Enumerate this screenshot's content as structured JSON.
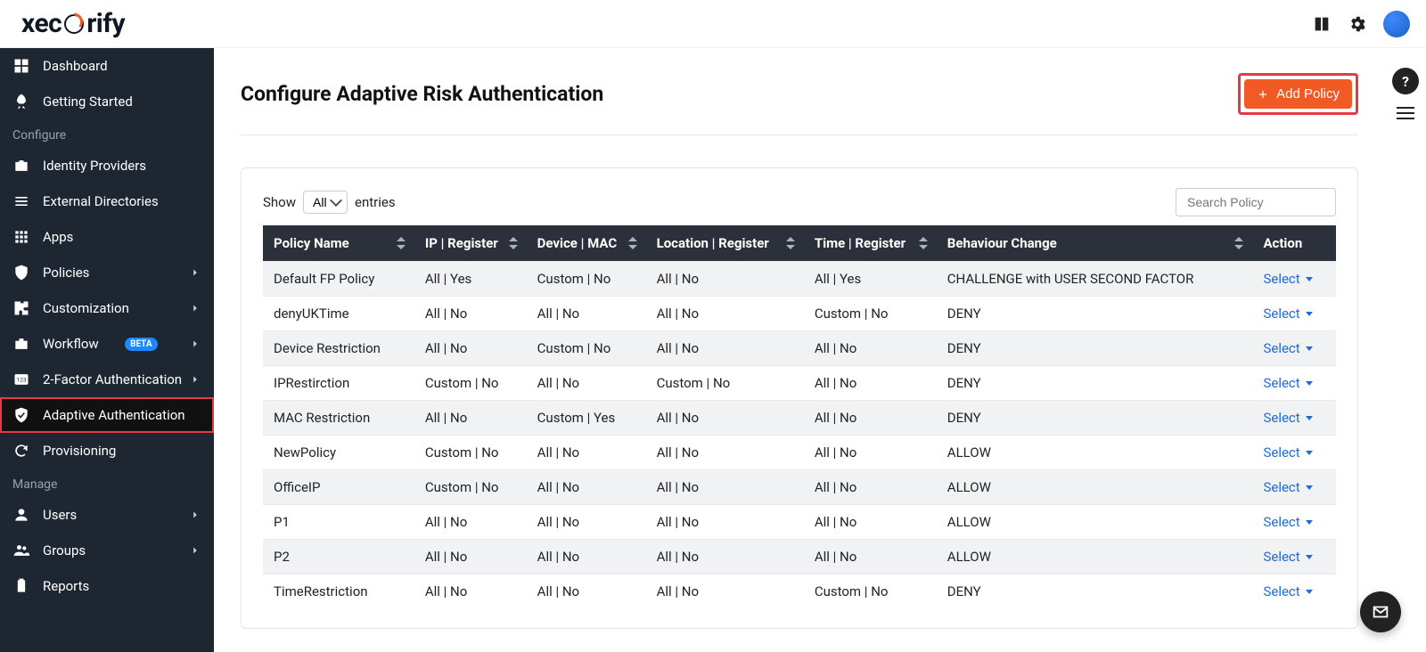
{
  "brand": {
    "name_part1": "xec",
    "name_part2": "rify"
  },
  "sidebar": {
    "items": [
      {
        "label": "Dashboard",
        "icon": "tiles-icon"
      },
      {
        "label": "Getting Started",
        "icon": "rocket-icon"
      }
    ],
    "section_configure": "Configure",
    "configure_items": [
      {
        "label": "Identity Providers",
        "icon": "briefcase-plus-icon"
      },
      {
        "label": "External Directories",
        "icon": "list-icon"
      },
      {
        "label": "Apps",
        "icon": "grid-icon"
      },
      {
        "label": "Policies",
        "icon": "shield-icon",
        "expandable": true
      },
      {
        "label": "Customization",
        "icon": "puzzle-icon",
        "expandable": true
      },
      {
        "label": "Workflow",
        "icon": "briefcase-icon",
        "expandable": true,
        "badge": "BETA"
      },
      {
        "label": "2-Factor Authentication",
        "icon": "keypad-icon",
        "expandable": true
      },
      {
        "label": "Adaptive Authentication",
        "icon": "shield-check-icon",
        "active": true
      },
      {
        "label": "Provisioning",
        "icon": "sync-icon"
      }
    ],
    "section_manage": "Manage",
    "manage_items": [
      {
        "label": "Users",
        "icon": "person-icon",
        "expandable": true
      },
      {
        "label": "Groups",
        "icon": "group-icon",
        "expandable": true
      },
      {
        "label": "Reports",
        "icon": "clipboard-icon"
      }
    ]
  },
  "header": {
    "title": "Configure Adaptive Risk Authentication",
    "add_button": "Add Policy"
  },
  "table": {
    "show_label_before": "Show",
    "show_value": "All",
    "show_label_after": "entries",
    "search_placeholder": "Search Policy",
    "columns": [
      "Policy Name",
      "IP | Register",
      "Device | MAC",
      "Location | Register",
      "Time | Register",
      "Behaviour Change",
      "Action"
    ],
    "action_label": "Select",
    "rows": [
      {
        "name": "Default FP Policy",
        "ip": "All | Yes",
        "device": "Custom | No",
        "location": "All | No",
        "time": "All | Yes",
        "behaviour": "CHALLENGE with USER SECOND FACTOR"
      },
      {
        "name": "denyUKTime",
        "ip": "All | No",
        "device": "All | No",
        "location": "All | No",
        "time": "Custom | No",
        "behaviour": "DENY"
      },
      {
        "name": "Device Restriction",
        "ip": "All | No",
        "device": "Custom | No",
        "location": "All | No",
        "time": "All | No",
        "behaviour": "DENY"
      },
      {
        "name": "IPRestirction",
        "ip": "Custom | No",
        "device": "All | No",
        "location": "Custom | No",
        "time": "All | No",
        "behaviour": "DENY"
      },
      {
        "name": "MAC Restriction",
        "ip": "All | No",
        "device": "Custom | Yes",
        "location": "All | No",
        "time": "All | No",
        "behaviour": "DENY"
      },
      {
        "name": "NewPolicy",
        "ip": "Custom | No",
        "device": "All | No",
        "location": "All | No",
        "time": "All | No",
        "behaviour": "ALLOW"
      },
      {
        "name": "OfficeIP",
        "ip": "Custom | No",
        "device": "All | No",
        "location": "All | No",
        "time": "All | No",
        "behaviour": "ALLOW"
      },
      {
        "name": "P1",
        "ip": "All | No",
        "device": "All | No",
        "location": "All | No",
        "time": "All | No",
        "behaviour": "ALLOW"
      },
      {
        "name": "P2",
        "ip": "All | No",
        "device": "All | No",
        "location": "All | No",
        "time": "All | No",
        "behaviour": "ALLOW"
      },
      {
        "name": "TimeRestriction",
        "ip": "All | No",
        "device": "All | No",
        "location": "All | No",
        "time": "Custom | No",
        "behaviour": "DENY"
      }
    ]
  }
}
